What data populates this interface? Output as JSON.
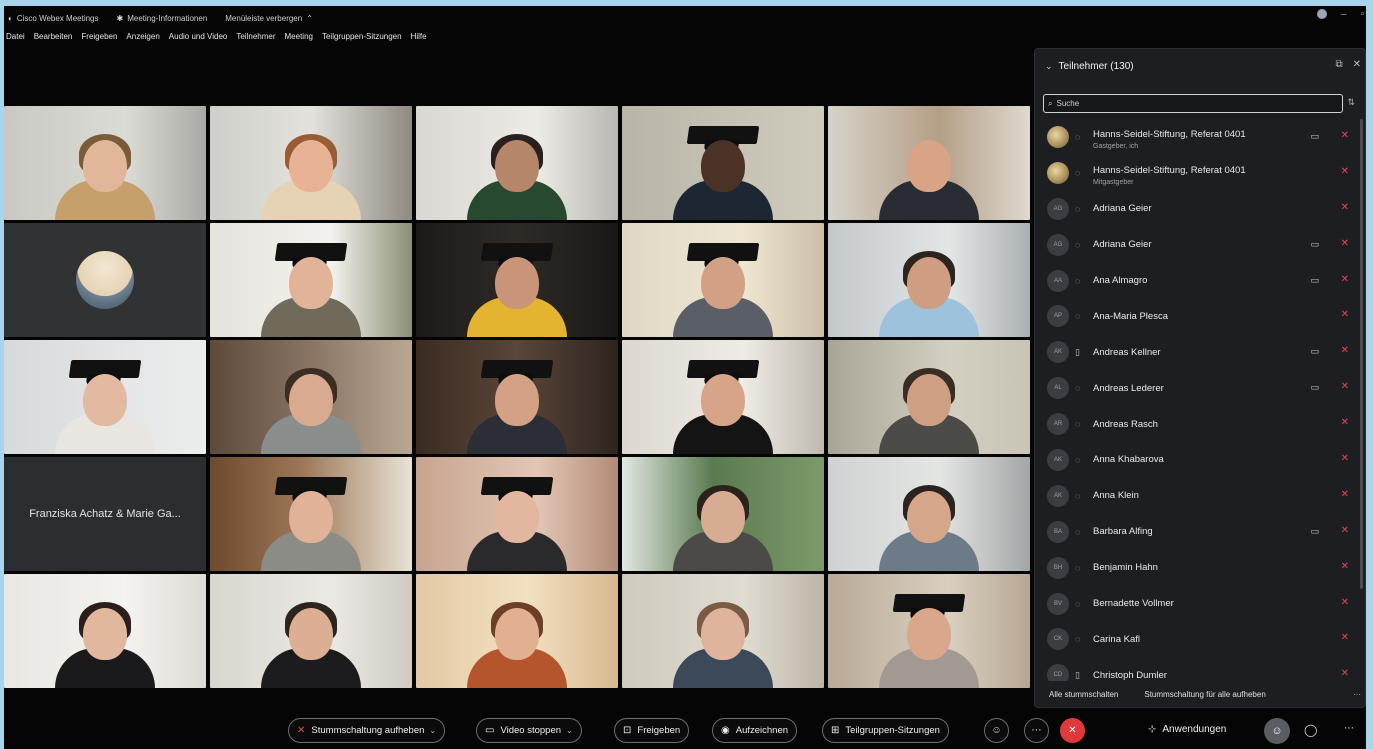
{
  "titlebar": {
    "app_name": "Cisco Webex Meetings",
    "meeting_info": "Meeting-Informationen",
    "hide_menu": "Menüleiste verbergen"
  },
  "menu": [
    "Datei",
    "Bearbeiten",
    "Freigeben",
    "Anzeigen",
    "Audio und Video",
    "Teilnehmer",
    "Meeting",
    "Teilgruppen-Sitzungen",
    "Hilfe"
  ],
  "grid": {
    "name_tile_text": "Franziska Achatz & Marie Ga..."
  },
  "panel": {
    "title": "Teilnehmer (130)",
    "search_placeholder": "Suche",
    "participants": [
      {
        "name": "Hanns-Seidel-Stiftung, Referat 0401",
        "role": "Gastgeber, ich",
        "initials": "",
        "photo": true,
        "device": "audio",
        "camera": true
      },
      {
        "name": "Hanns-Seidel-Stiftung, Referat 0401",
        "role": "Mitgastgeber",
        "initials": "",
        "photo": true,
        "device": "audio",
        "camera": false
      },
      {
        "name": "Adriana Geier",
        "role": "",
        "initials": "AG",
        "photo": false,
        "device": "audio",
        "camera": false
      },
      {
        "name": "Adriana Geier",
        "role": "",
        "initials": "AG",
        "photo": false,
        "device": "audio",
        "camera": true
      },
      {
        "name": "Ana Almagro",
        "role": "",
        "initials": "AA",
        "photo": false,
        "device": "audio",
        "camera": true
      },
      {
        "name": "Ana-Maria Plesca",
        "role": "",
        "initials": "AP",
        "photo": false,
        "device": "audio",
        "camera": false
      },
      {
        "name": "Andreas Kellner",
        "role": "",
        "initials": "AK",
        "photo": false,
        "device": "phone",
        "camera": true
      },
      {
        "name": "Andreas Lederer",
        "role": "",
        "initials": "AL",
        "photo": false,
        "device": "audio",
        "camera": true
      },
      {
        "name": "Andreas Rasch",
        "role": "",
        "initials": "AR",
        "photo": false,
        "device": "audio",
        "camera": false
      },
      {
        "name": "Anna Khabarova",
        "role": "",
        "initials": "AK",
        "photo": false,
        "device": "audio",
        "camera": false
      },
      {
        "name": "Anna Klein",
        "role": "",
        "initials": "AK",
        "photo": false,
        "device": "audio",
        "camera": false
      },
      {
        "name": "Barbara Alfing",
        "role": "",
        "initials": "BA",
        "photo": false,
        "device": "audio",
        "camera": true
      },
      {
        "name": "Benjamin Hahn",
        "role": "",
        "initials": "BH",
        "photo": false,
        "device": "audio",
        "camera": false
      },
      {
        "name": "Bernadette Vollmer",
        "role": "",
        "initials": "BV",
        "photo": false,
        "device": "audio",
        "camera": false
      },
      {
        "name": "Carina Kafl",
        "role": "",
        "initials": "CK",
        "photo": false,
        "device": "audio",
        "camera": false
      },
      {
        "name": "Christoph Dumler",
        "role": "",
        "initials": "CD",
        "photo": false,
        "device": "phone",
        "camera": false
      }
    ],
    "mute_all": "Alle stummschalten",
    "unmute_all": "Stummschaltung für alle aufheben"
  },
  "toolbar": {
    "unmute": "Stummschaltung aufheben",
    "stop_video": "Video stoppen",
    "share": "Freigeben",
    "record": "Aufzeichnen",
    "breakout": "Teilgruppen-Sitzungen",
    "apps": "Anwendungen"
  },
  "colors": {
    "accent_red": "#e0393b",
    "panel_bg": "#1c1e22",
    "window_bg": "#050505"
  }
}
